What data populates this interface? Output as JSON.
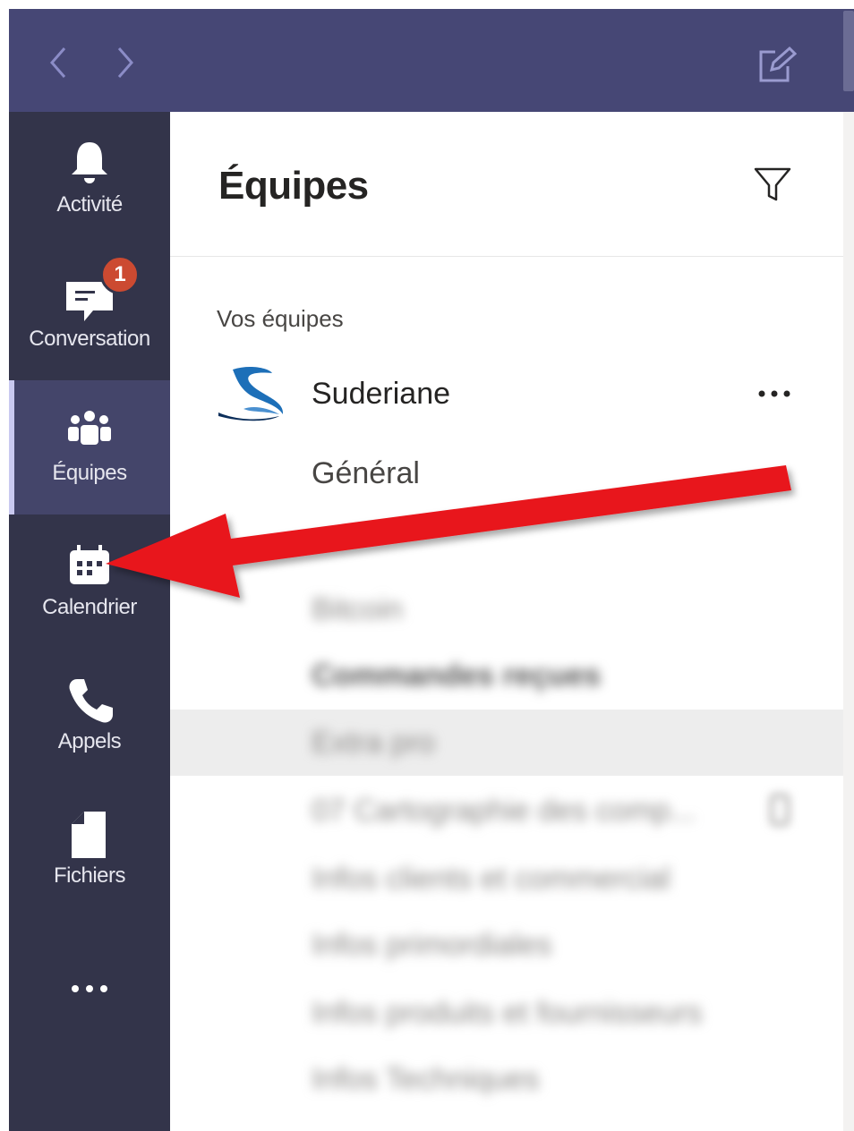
{
  "topbar": {
    "back_icon": "chevron-left-icon",
    "forward_icon": "chevron-right-icon",
    "compose_icon": "compose-icon"
  },
  "rail": {
    "items": [
      {
        "label": "Activité",
        "icon": "bell-icon"
      },
      {
        "label": "Conversation",
        "icon": "chat-icon",
        "badge": "1"
      },
      {
        "label": "Équipes",
        "icon": "teams-icon",
        "active": true
      },
      {
        "label": "Calendrier",
        "icon": "calendar-icon"
      },
      {
        "label": "Appels",
        "icon": "phone-icon"
      },
      {
        "label": "Fichiers",
        "icon": "file-icon"
      }
    ],
    "more_icon": "ellipsis-icon"
  },
  "main": {
    "title": "Équipes",
    "filter_icon": "filter-icon",
    "section_label": "Vos équipes",
    "team": {
      "name": "Suderiane",
      "more_icon": "ellipsis-icon"
    },
    "channels": [
      {
        "name": "Général"
      },
      {
        "name": "Bitcoin",
        "blurred": true
      },
      {
        "name": "Commandes reçues",
        "blurred": true,
        "bold": true
      },
      {
        "name": "Extra pro",
        "blurred": true,
        "highlighted": true
      },
      {
        "name": "07 Cartographie des comp...",
        "blurred": true
      },
      {
        "name": "Infos clients et commercial",
        "blurred": true
      },
      {
        "name": "Infos primordiales",
        "blurred": true
      },
      {
        "name": "Infos produits et fournisseurs",
        "blurred": true
      },
      {
        "name": "Infos Techniques",
        "blurred": true
      }
    ]
  },
  "overlay": {
    "arrow_color": "#e8141b"
  },
  "colors": {
    "topbar": "#464775",
    "rail": "#33344a",
    "rail_active": "#44456a",
    "badge": "#cc4a31"
  }
}
